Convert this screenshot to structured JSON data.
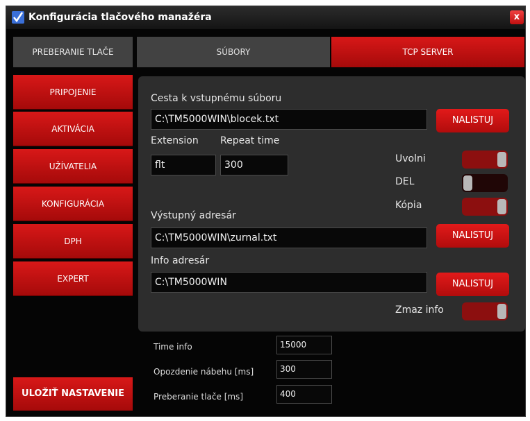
{
  "window": {
    "title": "Konfigurácia tlačového manažéra",
    "close_label": "x"
  },
  "sidebar": {
    "active_label": "PREBERANIE TLAČE",
    "items": [
      {
        "label": "PRIPOJENIE"
      },
      {
        "label": "AKTIVÁCIA"
      },
      {
        "label": "UŽÍVATELIA"
      },
      {
        "label": "KONFIGURÁCIA"
      },
      {
        "label": "DPH"
      },
      {
        "label": "EXPERT"
      }
    ],
    "save_label": "ULOŽIŤ NASTAVENIE"
  },
  "tabs": [
    {
      "label": "SÚBORY",
      "active": false
    },
    {
      "label": "TCP SERVER",
      "active": true
    }
  ],
  "panel": {
    "input_path_label": "Cesta k vstupnému súboru",
    "input_path_value": "C:\\TM5000WIN\\blocek.txt",
    "browse_label": "NALISTUJ",
    "extension_label": "Extension",
    "extension_value": "flt",
    "repeat_label": "Repeat time",
    "repeat_value": "300",
    "uvolni_label": "Uvolni",
    "uvolni_on": true,
    "del_label": "DEL",
    "del_on": false,
    "kopia_label": "Kópia",
    "kopia_on": true,
    "output_label": "Výstupný adresár",
    "output_value": "C:\\TM5000WIN\\zurnal.txt",
    "info_label": "Info adresár",
    "info_value": "C:\\TM5000WIN",
    "zmaz_label": "Zmaz info",
    "zmaz_on": true
  },
  "timing": {
    "time_info_label": "Time info",
    "time_info_value": "15000",
    "delay_label": "Opozdenie nábehu [ms]",
    "delay_value": "300",
    "pickup_label": "Preberanie tlače [ms]",
    "pickup_value": "400"
  },
  "colors": {
    "accent": "#c81212",
    "background": "#050505",
    "panel": "#2d2d2d"
  }
}
